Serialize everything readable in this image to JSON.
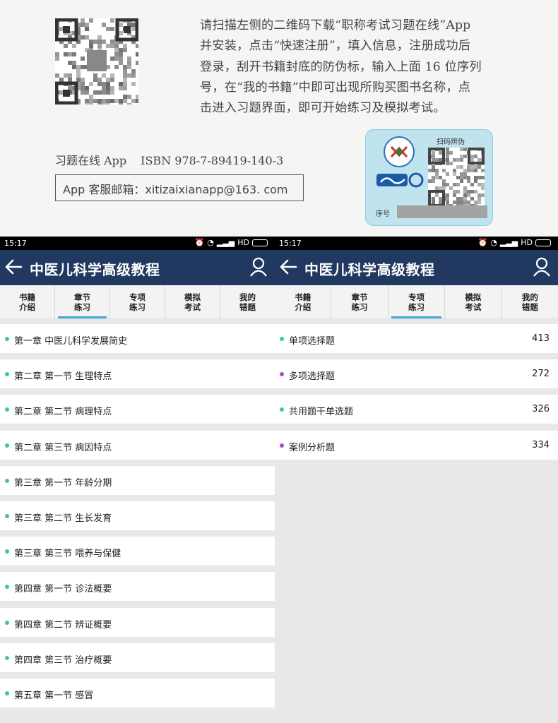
{
  "scan": {
    "instructions": [
      "请扫描左侧的二维码下载“职称考试习题在线”App",
      "并安装，点击“快速注册”，填入信息，注册成功后",
      "登录，刮开书籍封底的防伪标，输入上面 16 位序列",
      "号，在“我的书籍”中即可出现所购买图书名称，点",
      "击进入习题界面，即可开始练习及模拟考试。"
    ],
    "isbn_app": "习题在线 App",
    "isbn": "ISBN 978-7-89419-140-3",
    "email": "App 客服邮箱：xitizaixianapp@163. com",
    "anti_fake_title": "扫码辨伪",
    "serial_label": "序号"
  },
  "phones": [
    {
      "time": "15:17",
      "network": "HD",
      "title": "中医儿科学高级教程",
      "tabs": [
        {
          "line1": "书籍",
          "line2": "介绍",
          "active": false
        },
        {
          "line1": "章节",
          "line2": "练习",
          "active": true
        },
        {
          "line1": "专项",
          "line2": "练习",
          "active": false
        },
        {
          "line1": "模拟",
          "line2": "考试",
          "active": false
        },
        {
          "line1": "我的",
          "line2": "错题",
          "active": false
        }
      ],
      "items": [
        {
          "label": "第一章   中医儿科学发展简史",
          "count": "",
          "dot": "#3ec79c"
        },
        {
          "label": "第二章   第一节  生理特点",
          "count": "",
          "dot": "#3ec79c"
        },
        {
          "label": "第二章   第二节  病理特点",
          "count": "",
          "dot": "#3ec79c"
        },
        {
          "label": "第二章   第三节  病因特点",
          "count": "",
          "dot": "#3ec79c"
        },
        {
          "label": "第三章   第一节  年龄分期",
          "count": "",
          "dot": "#3ec79c"
        },
        {
          "label": "第三章   第二节  生长发育",
          "count": "",
          "dot": "#3ec79c"
        },
        {
          "label": "第三章   第三节  喂养与保健",
          "count": "",
          "dot": "#3ec79c"
        },
        {
          "label": "第四章   第一节  诊法概要",
          "count": "",
          "dot": "#3ec79c"
        },
        {
          "label": "第四章   第二节  辨证概要",
          "count": "",
          "dot": "#3ec79c"
        },
        {
          "label": "第四章   第三节  治疗概要",
          "count": "",
          "dot": "#3ec79c"
        },
        {
          "label": "第五章   第一节  感冒",
          "count": "",
          "dot": "#3ec79c"
        }
      ]
    },
    {
      "time": "15:17",
      "network": "HD",
      "title": "中医儿科学高级教程",
      "tabs": [
        {
          "line1": "书籍",
          "line2": "介绍",
          "active": false
        },
        {
          "line1": "章节",
          "line2": "练习",
          "active": false
        },
        {
          "line1": "专项",
          "line2": "练习",
          "active": true
        },
        {
          "line1": "模拟",
          "line2": "考试",
          "active": false
        },
        {
          "line1": "我的",
          "line2": "错题",
          "active": false
        }
      ],
      "items": [
        {
          "label": "单项选择题",
          "count": "413",
          "dot": "#3ec79c"
        },
        {
          "label": "多项选择题",
          "count": "272",
          "dot": "#a04fc6"
        },
        {
          "label": "共用题干单选题",
          "count": "326",
          "dot": "#3ec79c"
        },
        {
          "label": "案例分析题",
          "count": "334",
          "dot": "#a04fc6"
        }
      ]
    }
  ]
}
